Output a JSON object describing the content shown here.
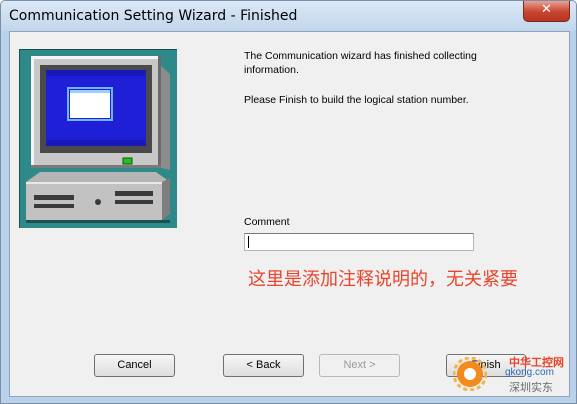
{
  "window": {
    "title": "Communication Setting Wizard - Finished",
    "close_glyph": "✕"
  },
  "content": {
    "message_line1": "The Communication wizard has finished collecting information.",
    "message_line2": "Please Finish to build the logical station number.",
    "comment_label": "Comment",
    "comment_value": "",
    "annotation": "这里是添加注释说明的，无关紧要"
  },
  "buttons": {
    "cancel": "Cancel",
    "back": "< Back",
    "next": "Next >",
    "finish": "Finish"
  },
  "watermark": {
    "line1": "中华工控网",
    "line2": "gkong.com",
    "line3": "深圳实东"
  },
  "colors": {
    "annotation": "#e8452c",
    "illustration_bg": "#2e8a88",
    "screen_blue": "#1f1fd8"
  },
  "icons": {
    "illustration": "computer-monitor-icon",
    "close": "close-icon",
    "watermark_logo": "gear-logo-icon"
  }
}
